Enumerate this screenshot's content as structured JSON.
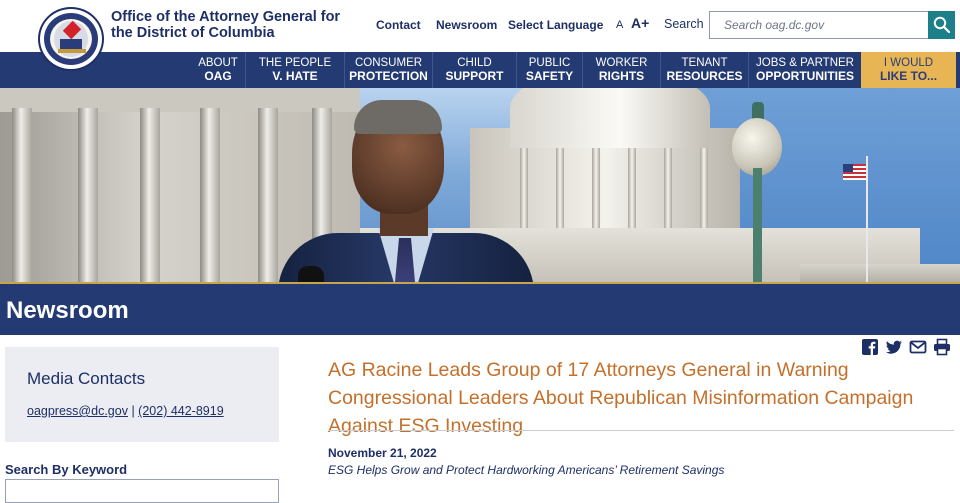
{
  "header": {
    "org_title": "Office of the Attorney General for the District of Columbia",
    "links": {
      "contact": "Contact",
      "newsroom": "Newsroom",
      "language": "Select Language"
    },
    "font_small": "A",
    "font_large": "A+",
    "search_label": "Search",
    "search_placeholder": "Search oag.dc.gov",
    "search_button_icon": "search-icon",
    "accent_color": "#1d7f8a"
  },
  "nav": {
    "items": [
      {
        "line1": "ABOUT",
        "line2": "OAG"
      },
      {
        "line1": "THE PEOPLE",
        "line2": "V. HATE"
      },
      {
        "line1": "CONSUMER",
        "line2": "PROTECTION"
      },
      {
        "line1": "CHILD",
        "line2": "SUPPORT"
      },
      {
        "line1": "PUBLIC",
        "line2": "SAFETY"
      },
      {
        "line1": "WORKER",
        "line2": "RIGHTS"
      },
      {
        "line1": "TENANT",
        "line2": "RESOURCES"
      },
      {
        "line1": "JOBS & PARTNER",
        "line2": "OPPORTUNITIES"
      }
    ],
    "cta": {
      "line1": "I WOULD",
      "line2": "LIKE TO..."
    },
    "bg_color": "#243a73",
    "cta_color": "#e8b554"
  },
  "band": {
    "title": "Newsroom"
  },
  "sidebar": {
    "media_title": "Media Contacts",
    "email": "oagpress@dc.gov",
    "separator": "|",
    "phone": "(202) 442-8919",
    "search_keyword_label": "Search By Keyword"
  },
  "share": [
    "facebook-icon",
    "twitter-icon",
    "email-icon",
    "print-icon"
  ],
  "article": {
    "title": "AG Racine Leads Group of 17 Attorneys General in Warning Congressional Leaders About Republican Misinformation Campaign Against ESG Investing",
    "date": "November 21, 2022",
    "subtitle": "ESG Helps Grow and Protect Hardworking Americans’ Retirement Savings",
    "title_color": "#c4702a"
  }
}
